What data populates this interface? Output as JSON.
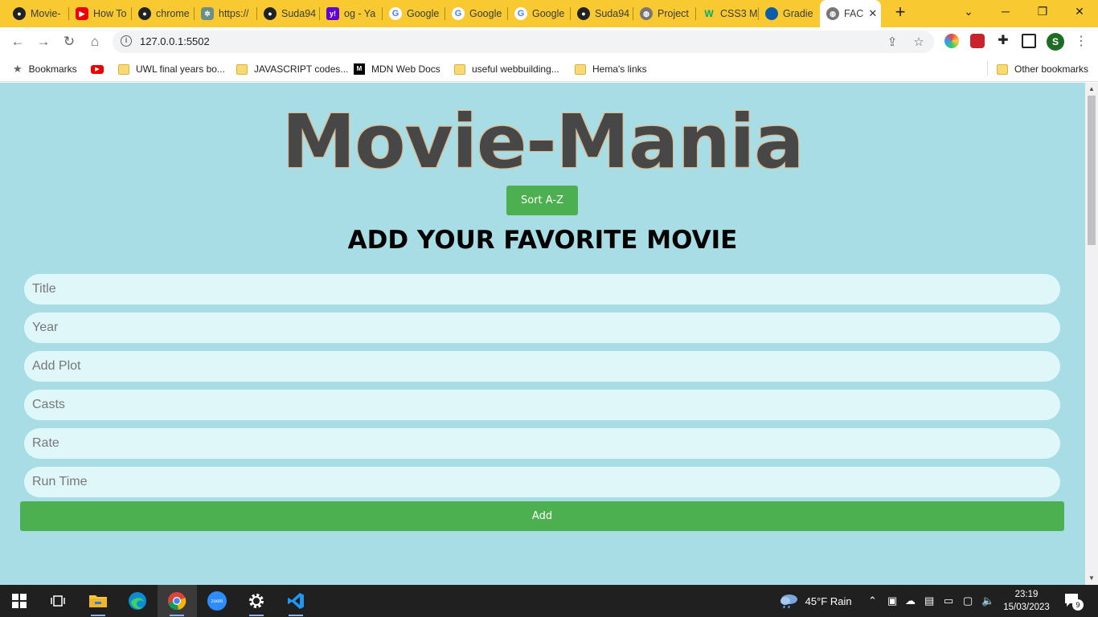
{
  "browser": {
    "tabs": [
      {
        "label": "Movie-",
        "icon": "github-icon"
      },
      {
        "label": "How To",
        "icon": "youtube-icon"
      },
      {
        "label": "chrome",
        "icon": "github-icon"
      },
      {
        "label": "https://",
        "icon": "chatgpt-icon"
      },
      {
        "label": "Suda94",
        "icon": "github-icon"
      },
      {
        "label": "og - Ya",
        "icon": "yahoo-icon"
      },
      {
        "label": "Google",
        "icon": "google-icon"
      },
      {
        "label": "Google",
        "icon": "google-icon"
      },
      {
        "label": "Google",
        "icon": "google-icon"
      },
      {
        "label": "Suda94",
        "icon": "github-icon"
      },
      {
        "label": "Project",
        "icon": "globe-icon"
      },
      {
        "label": "CSS3 M",
        "icon": "w3schools-icon"
      },
      {
        "label": "Gradie",
        "icon": "edge-icon"
      },
      {
        "label": "FAC",
        "icon": "globe-icon"
      }
    ],
    "url": "127.0.0.1:5502",
    "avatar_letter": "S"
  },
  "bookmarks": {
    "items": [
      {
        "label": "Bookmarks",
        "icon": "star-icon"
      },
      {
        "label": "",
        "icon": "youtube-icon"
      },
      {
        "label": "UWL final years bo...",
        "icon": "folder-icon"
      },
      {
        "label": "JAVASCRIPT codes...",
        "icon": "folder-icon"
      },
      {
        "label": "MDN Web Docs",
        "icon": "mdn-icon"
      },
      {
        "label": "useful webbuilding...",
        "icon": "folder-icon"
      },
      {
        "label": "Hema's links",
        "icon": "folder-icon"
      }
    ],
    "other": "Other bookmarks"
  },
  "page": {
    "title": "Movie-Mania",
    "sort_button": "Sort A-Z",
    "form_heading": "ADD YOUR FAVORITE MOVIE",
    "fields": [
      {
        "placeholder": "Title",
        "value": ""
      },
      {
        "placeholder": "Year",
        "value": ""
      },
      {
        "placeholder": "Add Plot",
        "value": ""
      },
      {
        "placeholder": "Casts",
        "value": ""
      },
      {
        "placeholder": "Rate",
        "value": ""
      },
      {
        "placeholder": "Run Time",
        "value": ""
      }
    ],
    "add_button": "Add"
  },
  "taskbar": {
    "weather": "45°F  Rain",
    "time": "23:19",
    "date": "15/03/2023",
    "notification_count": "9"
  },
  "colors": {
    "tabstrip": "#f9c932",
    "page_bg": "#a8dde6",
    "button_green": "#4caf50",
    "field_bg": "#dff7f9",
    "title_text": "#474747"
  }
}
